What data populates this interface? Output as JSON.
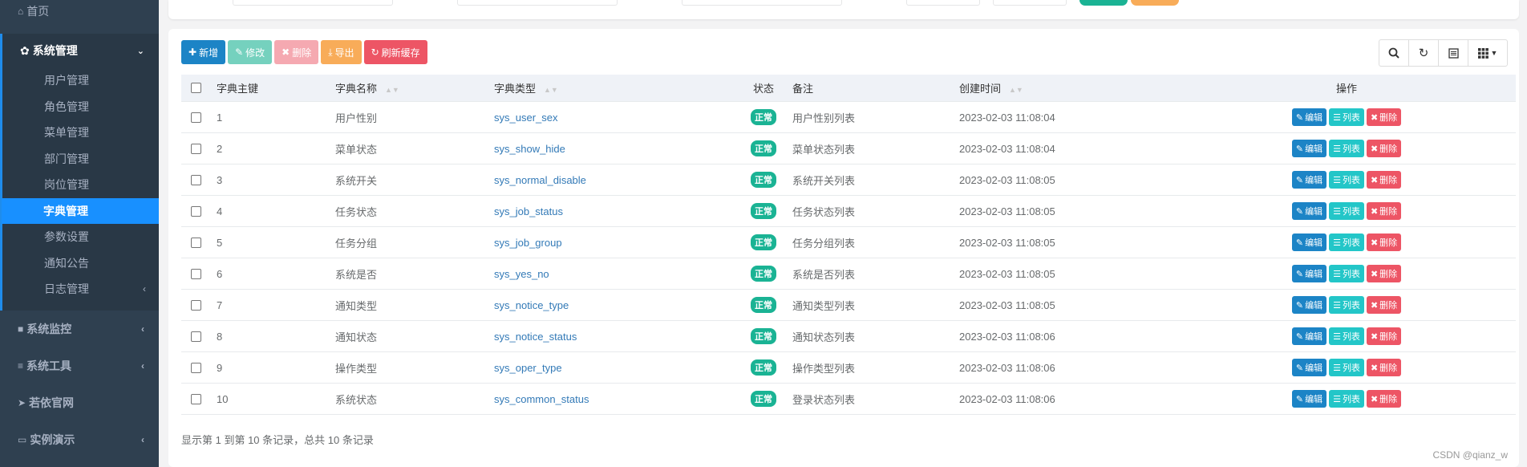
{
  "sidebar": {
    "home": "首页",
    "system_group": "系统管理",
    "sub_items": [
      {
        "label": "用户管理"
      },
      {
        "label": "角色管理"
      },
      {
        "label": "菜单管理"
      },
      {
        "label": "部门管理"
      },
      {
        "label": "岗位管理"
      },
      {
        "label": "字典管理"
      },
      {
        "label": "参数设置"
      },
      {
        "label": "通知公告"
      },
      {
        "label": "日志管理"
      }
    ],
    "monitor": "系统监控",
    "tools": "系统工具",
    "website": "若依官网",
    "demo": "实例演示",
    "active_index": 5
  },
  "toolbar": {
    "add": "新增",
    "edit": "修改",
    "delete": "删除",
    "export": "导出",
    "refresh_cache": "刷新缓存"
  },
  "table": {
    "headers": {
      "key": "字典主键",
      "name": "字典名称",
      "type": "字典类型",
      "status": "状态",
      "remark": "备注",
      "created": "创建时间",
      "actions": "操作"
    },
    "rows": [
      {
        "id": "1",
        "name": "用户性别",
        "type": "sys_user_sex",
        "status": "正常",
        "remark": "用户性别列表",
        "time": "2023-02-03 11:08:04"
      },
      {
        "id": "2",
        "name": "菜单状态",
        "type": "sys_show_hide",
        "status": "正常",
        "remark": "菜单状态列表",
        "time": "2023-02-03 11:08:04"
      },
      {
        "id": "3",
        "name": "系统开关",
        "type": "sys_normal_disable",
        "status": "正常",
        "remark": "系统开关列表",
        "time": "2023-02-03 11:08:05"
      },
      {
        "id": "4",
        "name": "任务状态",
        "type": "sys_job_status",
        "status": "正常",
        "remark": "任务状态列表",
        "time": "2023-02-03 11:08:05"
      },
      {
        "id": "5",
        "name": "任务分组",
        "type": "sys_job_group",
        "status": "正常",
        "remark": "任务分组列表",
        "time": "2023-02-03 11:08:05"
      },
      {
        "id": "6",
        "name": "系统是否",
        "type": "sys_yes_no",
        "status": "正常",
        "remark": "系统是否列表",
        "time": "2023-02-03 11:08:05"
      },
      {
        "id": "7",
        "name": "通知类型",
        "type": "sys_notice_type",
        "status": "正常",
        "remark": "通知类型列表",
        "time": "2023-02-03 11:08:05"
      },
      {
        "id": "8",
        "name": "通知状态",
        "type": "sys_notice_status",
        "status": "正常",
        "remark": "通知状态列表",
        "time": "2023-02-03 11:08:06"
      },
      {
        "id": "9",
        "name": "操作类型",
        "type": "sys_oper_type",
        "status": "正常",
        "remark": "操作类型列表",
        "time": "2023-02-03 11:08:06"
      },
      {
        "id": "10",
        "name": "系统状态",
        "type": "sys_common_status",
        "status": "正常",
        "remark": "登录状态列表",
        "time": "2023-02-03 11:08:06"
      }
    ],
    "row_actions": {
      "edit": "编辑",
      "list": "列表",
      "delete": "删除"
    }
  },
  "pagination": {
    "summary": "显示第 1 到第 10 条记录，总共 10 条记录"
  },
  "watermark": "CSDN @qianz_w",
  "colors": {
    "sidebar_bg": "#2f4050",
    "active_blue": "#1890ff",
    "primary": "#1c84c6",
    "success": "#1ab394",
    "info": "#23c6c8",
    "danger": "#ed5565",
    "warning": "#f8ac59"
  },
  "icons": {
    "home": "home-icon",
    "system": "gear-icon",
    "monitor": "video-icon",
    "tools": "bars-icon",
    "website": "send-icon",
    "demo": "desktop-icon"
  }
}
